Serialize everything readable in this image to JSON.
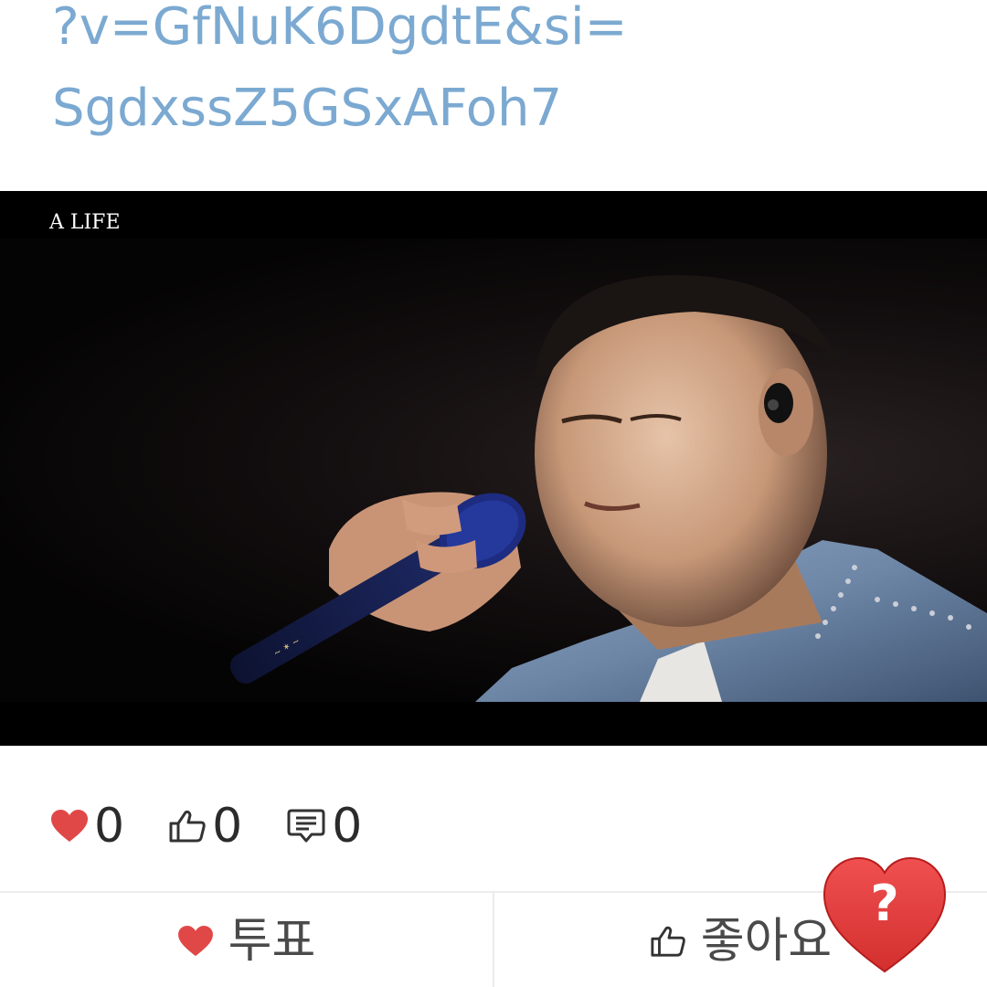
{
  "post": {
    "link_line1": "?v=GfNuK6DgdtE&si=",
    "link_line2": "SgdxssZ5GSxAFoh7"
  },
  "video": {
    "caption": "A LIFE"
  },
  "stats": {
    "hearts": "0",
    "likes": "0",
    "comments": "0"
  },
  "actions": {
    "vote_label": "투표",
    "like_label": "좋아요"
  },
  "badge": {
    "symbol": "?"
  },
  "colors": {
    "link": "#7ba9d1",
    "heart": "#e04848",
    "badge": "#e53935"
  }
}
